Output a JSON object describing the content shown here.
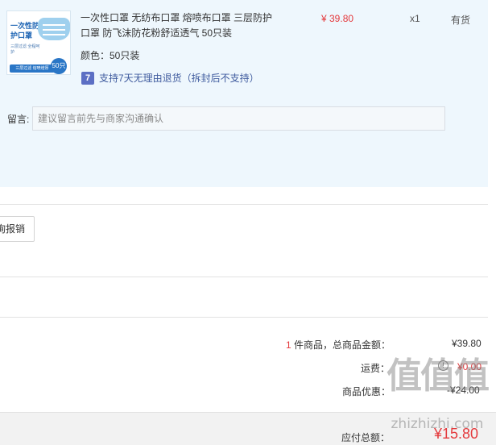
{
  "product": {
    "thumb_title": "一次性防护口罩",
    "thumb_sub": "三层过滤 全程呵护",
    "thumb_band": "三层过滤 熔喷增厚",
    "thumb_count": "50只",
    "title": "一次性口罩 无纺布口罩 熔喷布口罩 三层防护口罩 防飞沫防花粉舒适透气 50只装",
    "color_spec": "颜色：50只装",
    "return_badge": "7",
    "return_policy": "支持7天无理由退货（拆封后不支持）",
    "price": "¥ 39.80",
    "quantity": "x1",
    "stock": "有货"
  },
  "memo": {
    "label": "留言:",
    "placeholder": "建议留言前先与商家沟通确认"
  },
  "invoice": {
    "button_label": "询报销"
  },
  "summary": {
    "item_count": "1",
    "item_count_suffix": " 件商品，总商品金额：",
    "goods_total": "¥39.80",
    "shipping_label": "运费：",
    "shipping_value": "¥0.00",
    "discount_label": "商品优惠：",
    "discount_value": "-¥24.00",
    "payable_label": "应付总额：",
    "payable_value": "¥15.80"
  },
  "watermark": {
    "brand": "值值值",
    "url": "zhizhizhi.com"
  },
  "colors": {
    "accent_red": "#e4393c",
    "panel_bg": "#eef7fd"
  }
}
